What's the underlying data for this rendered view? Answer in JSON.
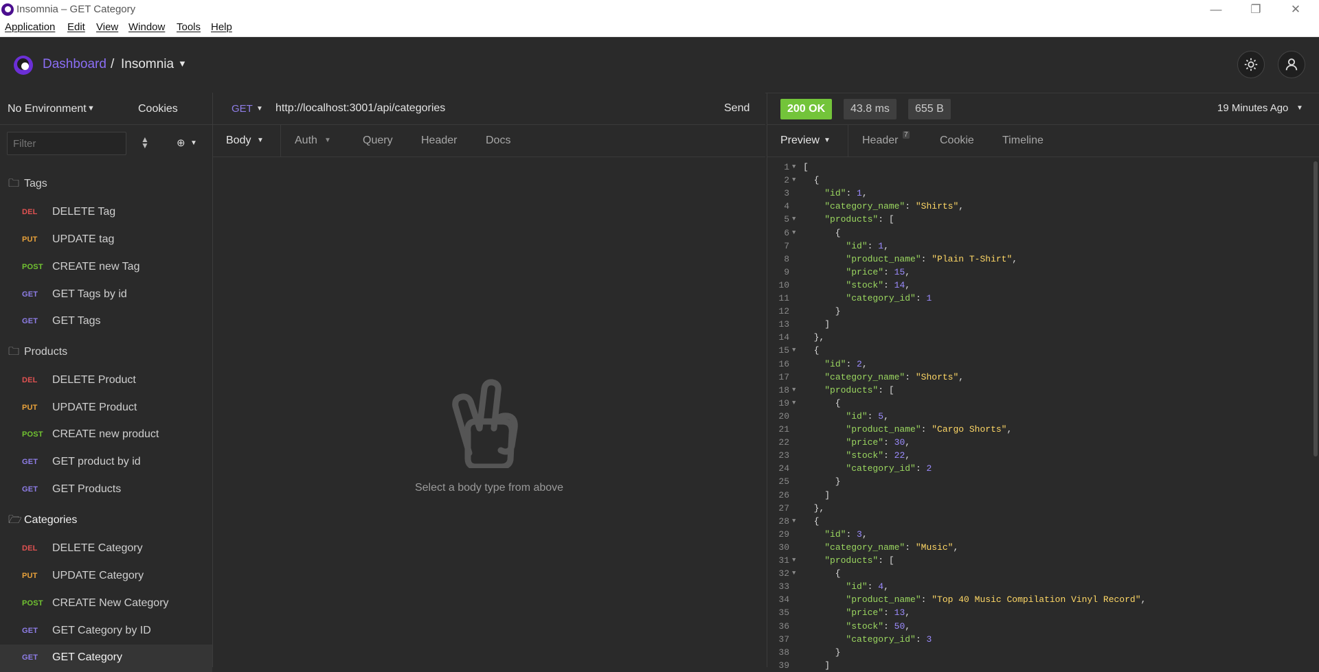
{
  "window": {
    "title": "Insomnia – GET Category"
  },
  "menu": [
    "Application",
    "Edit",
    "View",
    "Window",
    "Tools",
    "Help"
  ],
  "header": {
    "dashboard": "Dashboard",
    "separator": "/",
    "workspace": "Insomnia"
  },
  "sidebar": {
    "environment": "No Environment",
    "cookies": "Cookies",
    "filter_placeholder": "Filter",
    "folders": [
      {
        "name": "Tags",
        "items": [
          {
            "method": "DEL",
            "name": "DELETE Tag"
          },
          {
            "method": "PUT",
            "name": "UPDATE tag"
          },
          {
            "method": "POST",
            "name": "CREATE new Tag"
          },
          {
            "method": "GET",
            "name": "GET Tags by id"
          },
          {
            "method": "GET",
            "name": "GET Tags"
          }
        ]
      },
      {
        "name": "Products",
        "items": [
          {
            "method": "DEL",
            "name": "DELETE Product"
          },
          {
            "method": "PUT",
            "name": "UPDATE Product"
          },
          {
            "method": "POST",
            "name": "CREATE new product"
          },
          {
            "method": "GET",
            "name": "GET product by id"
          },
          {
            "method": "GET",
            "name": "GET Products"
          }
        ]
      },
      {
        "name": "Categories",
        "items": [
          {
            "method": "DEL",
            "name": "DELETE Category"
          },
          {
            "method": "PUT",
            "name": "UPDATE Category"
          },
          {
            "method": "POST",
            "name": "CREATE New Category"
          },
          {
            "method": "GET",
            "name": "GET Category by ID"
          },
          {
            "method": "GET",
            "name": "GET Category"
          }
        ]
      }
    ]
  },
  "request": {
    "method": "GET",
    "url": "http://localhost:3001/api/categories",
    "send": "Send",
    "tabs": [
      "Body",
      "Auth",
      "Query",
      "Header",
      "Docs"
    ],
    "empty_message": "Select a body type from above"
  },
  "response": {
    "status": "200 OK",
    "time": "43.8 ms",
    "size": "655 B",
    "age": "19 Minutes Ago",
    "tabs": [
      "Preview",
      "Header",
      "Cookie",
      "Timeline"
    ],
    "header_count": "7",
    "body_lines": [
      "[",
      "  {",
      "    \"id\": 1,",
      "    \"category_name\": \"Shirts\",",
      "    \"products\": [",
      "      {",
      "        \"id\": 1,",
      "        \"product_name\": \"Plain T-Shirt\",",
      "        \"price\": 15,",
      "        \"stock\": 14,",
      "        \"category_id\": 1",
      "      }",
      "    ]",
      "  },",
      "  {",
      "    \"id\": 2,",
      "    \"category_name\": \"Shorts\",",
      "    \"products\": [",
      "      {",
      "        \"id\": 5,",
      "        \"product_name\": \"Cargo Shorts\",",
      "        \"price\": 30,",
      "        \"stock\": 22,",
      "        \"category_id\": 2",
      "      }",
      "    ]",
      "  },",
      "  {",
      "    \"id\": 3,",
      "    \"category_name\": \"Music\",",
      "    \"products\": [",
      "      {",
      "        \"id\": 4,",
      "        \"product_name\": \"Top 40 Music Compilation Vinyl Record\",",
      "        \"price\": 13,",
      "        \"stock\": 50,",
      "        \"category_id\": 3",
      "      }",
      "    ]"
    ]
  }
}
